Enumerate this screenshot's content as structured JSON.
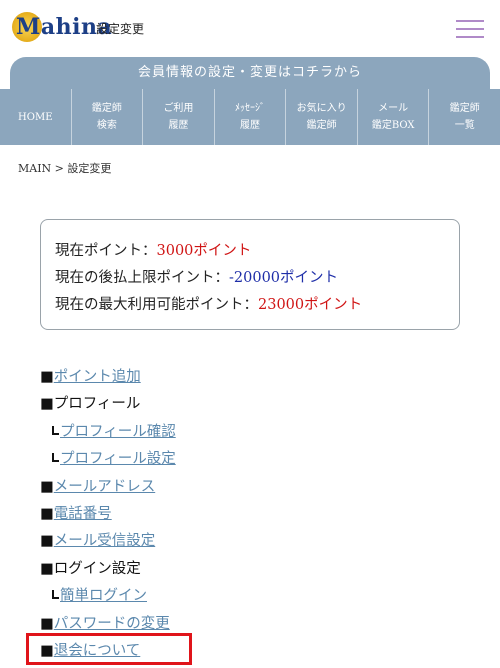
{
  "header": {
    "logo_text": "Mahina",
    "page_name": "設定変更"
  },
  "member_bar": {
    "label": "会員情報の設定・変更はコチラから"
  },
  "nav": {
    "items": [
      "HOME",
      "鑑定師\n検索",
      "ご利用\n履歴",
      "ﾒｯｾｰｼﾞ\n履歴",
      "お気に入り\n鑑定師",
      "メール\n鑑定BOX",
      "鑑定師\n一覧"
    ]
  },
  "breadcrumb": "MAIN > 設定変更",
  "points": {
    "current_label": "現在ポイント：",
    "current_value": "3000ポイント",
    "postpay_label": "現在の後払上限ポイント：",
    "postpay_value": "-20000ポイント",
    "max_label": "現在の最大利用可能ポイント：",
    "max_value": "23000ポイント"
  },
  "menu": {
    "bullet": "■",
    "add_points": "ポイント追加",
    "profile": "プロフィール",
    "profile_check": "プロフィール確認",
    "profile_settings": "プロフィール設定",
    "email": "メールアドレス",
    "phone": "電話番号",
    "mail_settings": "メール受信設定",
    "login_settings": "ログイン設定",
    "easy_login": "簡単ログイン",
    "password_change": "パスワードの変更",
    "withdrawal": "退会について"
  },
  "colors": {
    "nav_bg": "#8ca6bd",
    "link": "#5b88ad",
    "value_red": "#d01414",
    "value_blue": "#1e2ea8",
    "highlight_border": "#e0141a"
  }
}
